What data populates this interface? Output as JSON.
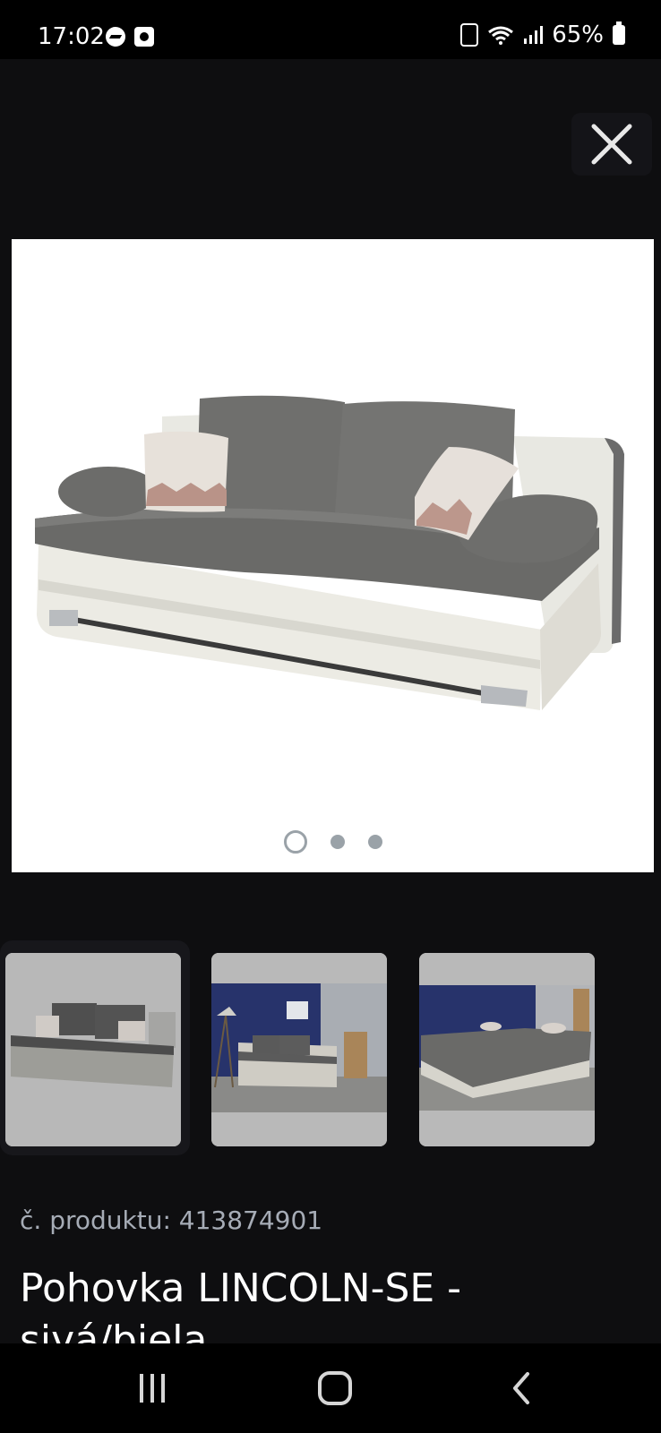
{
  "status_bar": {
    "time": "17:02",
    "battery": "65%",
    "icons": [
      "messenger-icon",
      "screen-record-icon",
      "battery-saver-icon",
      "wifi-icon",
      "signal-icon",
      "battery-icon"
    ]
  },
  "viewer": {
    "close_icon": "close-icon",
    "carousel_pages": 3,
    "carousel_active_index": 0,
    "thumbnails": [
      {
        "name": "thumbnail-1",
        "selected": true
      },
      {
        "name": "thumbnail-2",
        "selected": false
      },
      {
        "name": "thumbnail-3",
        "selected": false
      }
    ]
  },
  "product": {
    "number": "č. produktu: 413874901",
    "title": "Pohovka LINCOLN-SE - sivá/biela"
  },
  "nav_bar": {
    "icons": [
      "recent-apps-icon",
      "home-icon",
      "back-icon"
    ]
  },
  "colors": {
    "background": "#0e0e10",
    "status_bar": "#000000",
    "muted_text": "#a6acb6",
    "dot": "#9aa2a8"
  }
}
